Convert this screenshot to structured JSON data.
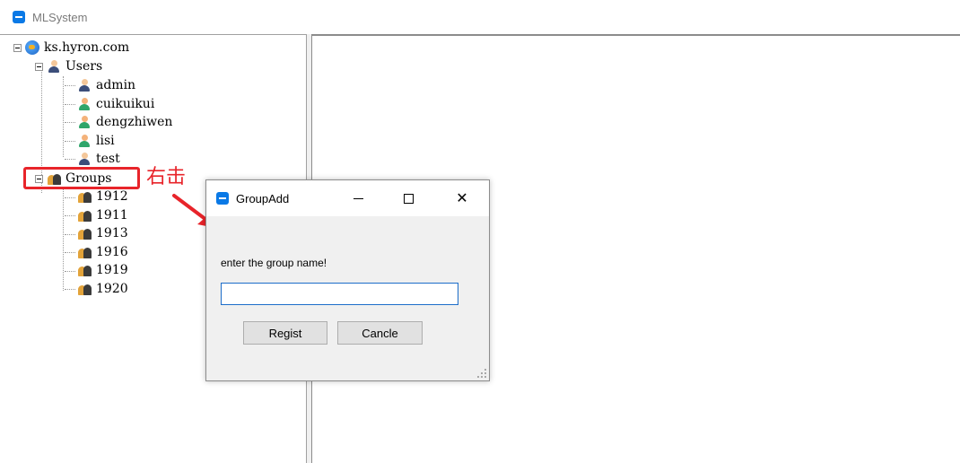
{
  "app": {
    "title": "MLSystem"
  },
  "tree": {
    "root": {
      "label": "ks.hyron.com",
      "icon": "domain-globe-icon"
    },
    "users": {
      "label": "Users",
      "icon": "users-icon",
      "items": [
        "admin",
        "cuikuikui",
        "dengzhiwen",
        "lisi",
        "test"
      ]
    },
    "groups": {
      "label": "Groups",
      "icon": "groups-icon",
      "items": [
        "1912",
        "1911",
        "1913",
        "1916",
        "1919",
        "1920"
      ]
    }
  },
  "annotation": {
    "text": "右击",
    "color": "#e8242a"
  },
  "dialog": {
    "title": "GroupAdd",
    "minimize_label": "",
    "close_label": "✕",
    "prompt": "enter the group name!",
    "input_value": "",
    "input_placeholder": "",
    "regist_label": "Regist",
    "cancle_label": "Cancle"
  },
  "colors": {
    "accent": "#0a79e6",
    "input_border": "#1c6dc9",
    "annotation": "#e8242a"
  }
}
